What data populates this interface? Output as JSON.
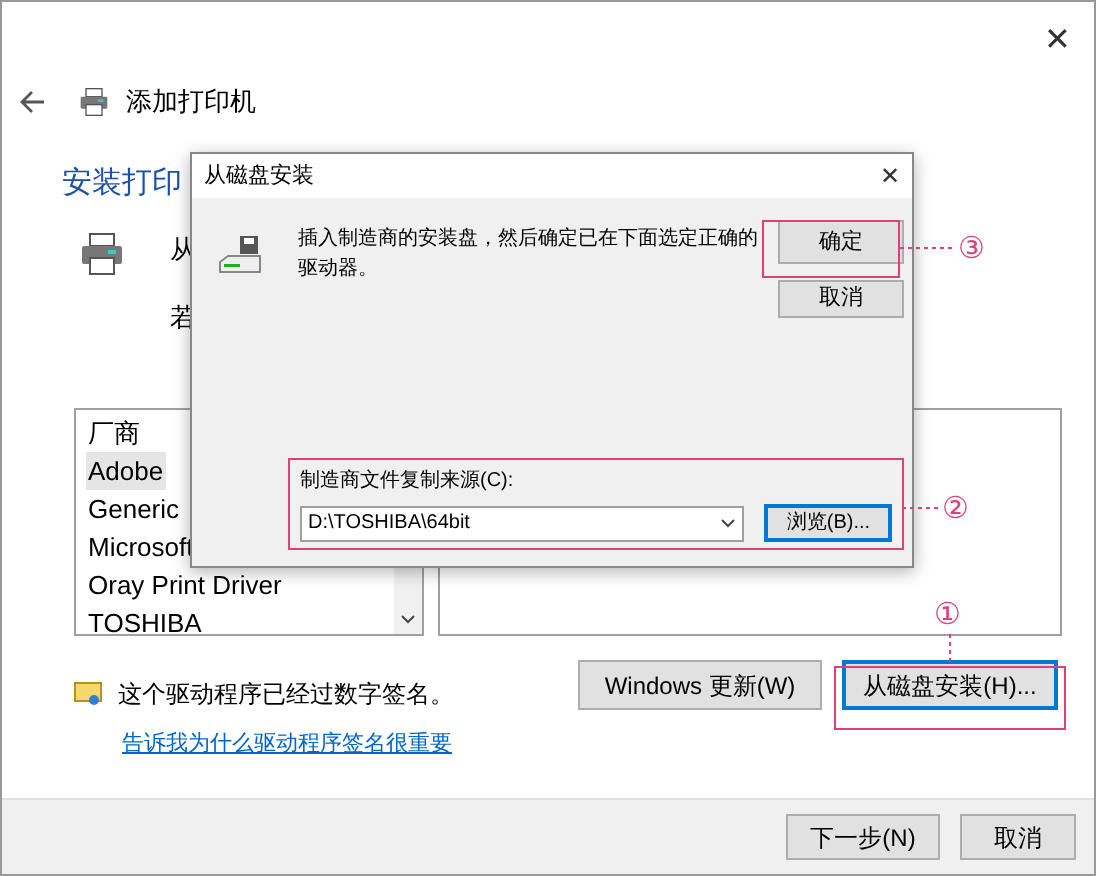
{
  "window": {
    "title": "添加打印机",
    "close": "✕"
  },
  "heading": "安装打印",
  "intro_lines": [
    "从",
    "若"
  ],
  "manufacturers": {
    "header": "厂商",
    "items": [
      {
        "label": "Adobe",
        "selected": true
      },
      {
        "label": "Generic",
        "selected": false
      },
      {
        "label": "Microsoft",
        "selected": false
      },
      {
        "label": "Oray Print Driver",
        "selected": false
      },
      {
        "label": "TOSHIBA",
        "selected": false
      }
    ]
  },
  "signature_note": "这个驱动程序已经过数字签名。",
  "signature_link": "告诉我为什么驱动程序签名很重要",
  "windows_update_button": "Windows 更新(W)",
  "have_disk_button": {
    "label": "从磁盘安装(H)...",
    "focused": true
  },
  "footer_buttons": [
    {
      "label": "下一步(N)"
    },
    {
      "label": "取消"
    }
  ],
  "dialog": {
    "title": "从磁盘安装",
    "close": "✕",
    "message": "插入制造商的安装盘，然后确定已在下面选定正确的驱动器。",
    "ok": "确定",
    "cancel": "取消",
    "source_label": "制造商文件复制来源(C):",
    "source_value": "D:\\TOSHIBA\\64bit",
    "browse": {
      "label": "浏览(B)...",
      "focused": true
    }
  },
  "callouts": [
    {
      "number": "①"
    },
    {
      "number": "②"
    },
    {
      "number": "③"
    }
  ]
}
